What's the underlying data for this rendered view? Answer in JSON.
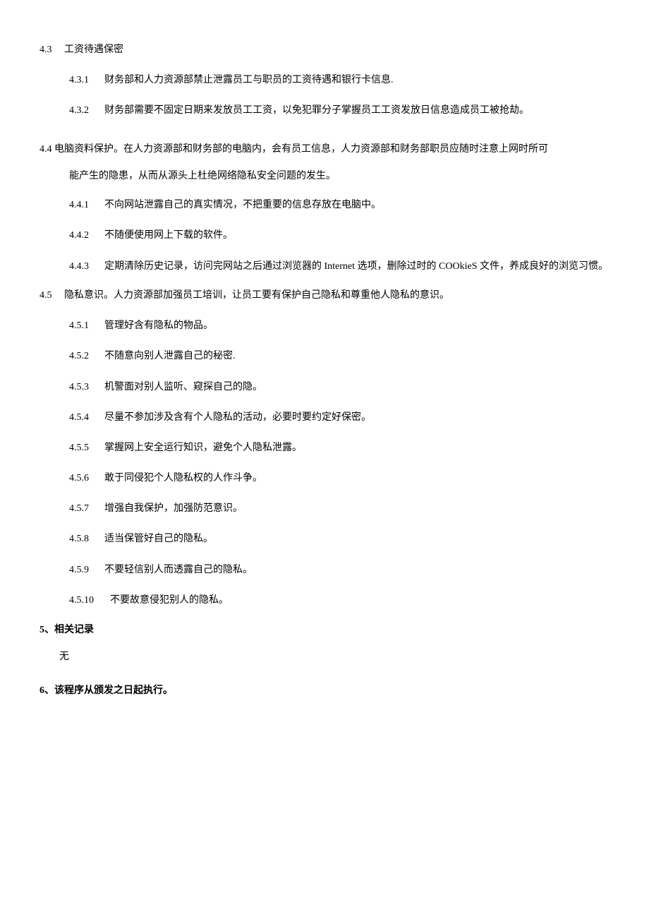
{
  "doc": {
    "s4_3": {
      "num": "4.3",
      "title": "工资待遇保密"
    },
    "s4_3_1": {
      "num": "4.3.1",
      "text": "财务部和人力资源部禁止泄露员工与职员的工资待遇和银行卡信息."
    },
    "s4_3_2": {
      "num": "4.3.2",
      "text": "财务部需要不固定日期来发放员工工资，以免犯罪分子掌握员工工资发放日信息造成员工被抢劫。"
    },
    "s4_4": {
      "num": "4.4",
      "text_a": "电脑资料保护。在人力资源部和财务部的电脑内，会有员工信息，人力资源部和财务部职员应随时注意上网时所可",
      "text_b": "能产生的隐患，从而从源头上杜绝网络隐私安全问题的发生。"
    },
    "s4_4_1": {
      "num": "4.4.1",
      "text": "不向网站泄露自己的真实情况，不把重要的信息存放在电脑中。"
    },
    "s4_4_2": {
      "num": "4.4.2",
      "text": "不随便使用网上下载的软件。"
    },
    "s4_4_3": {
      "num": "4.4.3",
      "text": "定期清除历史记录，访问完网站之后通过浏览器的 Internet 选项，删除过时的 COOkieS 文件，养成良好的浏览习惯。"
    },
    "s4_5": {
      "num": "4.5",
      "title": "隐私意识。人力资源部加强员工培训，让员工要有保护自己隐私和尊重他人隐私的意识。"
    },
    "s4_5_1": {
      "num": "4.5.1",
      "text": "管理好含有隐私的物品。"
    },
    "s4_5_2": {
      "num": "4.5.2",
      "text": "不随意向别人泄露自己的秘密."
    },
    "s4_5_3": {
      "num": "4.5.3",
      "text": "机警面对别人监听、窥探自己的隐。"
    },
    "s4_5_4": {
      "num": "4.5.4",
      "text": "尽量不参加涉及含有个人隐私的活动，必要时要约定好保密。"
    },
    "s4_5_5": {
      "num": "4.5.5",
      "text": "掌握网上安全运行知识，避免个人隐私泄露。"
    },
    "s4_5_6": {
      "num": "4.5.6",
      "text": "敢于同侵犯个人隐私权的人作斗争。"
    },
    "s4_5_7": {
      "num": "4.5.7",
      "text": "增强自我保护，加强防范意识。"
    },
    "s4_5_8": {
      "num": "4.5.8",
      "text": "适当保管好自己的隐私。"
    },
    "s4_5_9": {
      "num": "4.5.9",
      "text": "不要轻信别人而透露自己的隐私。"
    },
    "s4_5_10": {
      "num": "4.5.10",
      "text": "不要故意侵犯别人的隐私。"
    },
    "s5": {
      "heading": "5、相关记录",
      "body": "无"
    },
    "s6": {
      "heading": "6、该程序从颁发之日起执行。"
    }
  }
}
